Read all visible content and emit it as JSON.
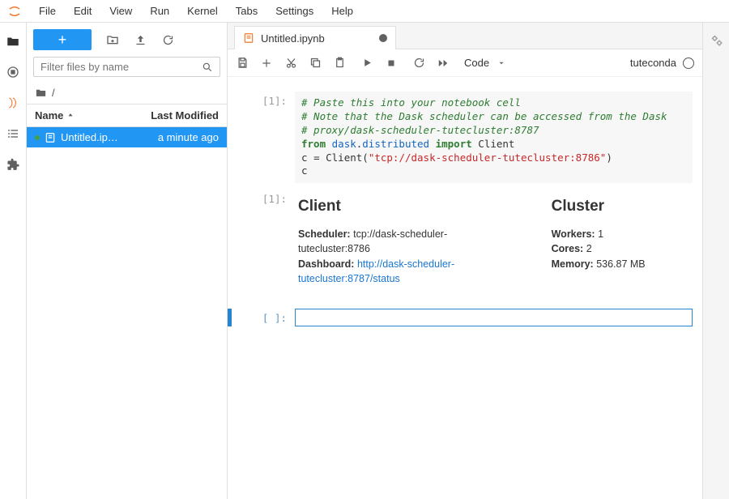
{
  "menu": [
    "File",
    "Edit",
    "View",
    "Run",
    "Kernel",
    "Tabs",
    "Settings",
    "Help"
  ],
  "filebrowser": {
    "filter_placeholder": "Filter files by name",
    "breadcrumb_root": "/",
    "columns": {
      "name": "Name",
      "modified": "Last Modified"
    },
    "items": [
      {
        "name": "Untitled.ip…",
        "modified": "a minute ago",
        "running": true,
        "selected": true
      }
    ]
  },
  "tab": {
    "title": "Untitled.ipynb",
    "dirty": true
  },
  "notebook": {
    "cell_type": "Code",
    "kernel_name": "tuteconda",
    "cells": [
      {
        "prompt": "[1]:",
        "code": {
          "c1": "# Paste this into your notebook cell",
          "c2": "# Note that the Dask scheduler can be accessed from the Dask",
          "c3": "# proxy/dask-scheduler-tutecluster:8787",
          "kw_from": "from",
          "mod1": "dask",
          "dot": ".",
          "mod2": "distributed",
          "kw_import": "import",
          "cls": "Client",
          "assign": "c ",
          "eq": "=",
          "call": " Client(",
          "str": "\"tcp://dask-scheduler-tutecluster:8786\"",
          "close": ")",
          "last": "c"
        }
      }
    ],
    "output_prompt": "[1]:",
    "output": {
      "client": {
        "title": "Client",
        "scheduler_label": "Scheduler:",
        "scheduler_value": "tcp://dask-scheduler-tutecluster:8786",
        "dashboard_label": "Dashboard:",
        "dashboard_link": "http://dask-scheduler-tutecluster:8787/status"
      },
      "cluster": {
        "title": "Cluster",
        "workers_label": "Workers:",
        "workers_value": "1",
        "cores_label": "Cores:",
        "cores_value": "2",
        "memory_label": "Memory:",
        "memory_value": "536.87 MB"
      }
    },
    "empty_prompt": "[ ]:"
  }
}
